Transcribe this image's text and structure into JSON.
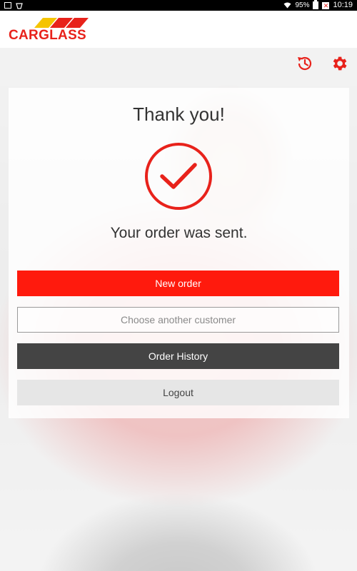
{
  "status_bar": {
    "battery": "95%",
    "time": "10:19"
  },
  "header": {
    "logo_text": "CARGLASS"
  },
  "toolbar": {
    "icons": [
      "history-icon",
      "settings-icon"
    ]
  },
  "card": {
    "title": "Thank you!",
    "message": "Your order was sent.",
    "buttons": {
      "new_order": "New order",
      "choose_customer": "Choose another customer",
      "order_history": "Order History",
      "logout": "Logout"
    }
  },
  "colors": {
    "accent": "#ff1a0d",
    "brand_red": "#e8221b",
    "logo_yellow": "#f5c400",
    "dark_button": "#444444"
  }
}
